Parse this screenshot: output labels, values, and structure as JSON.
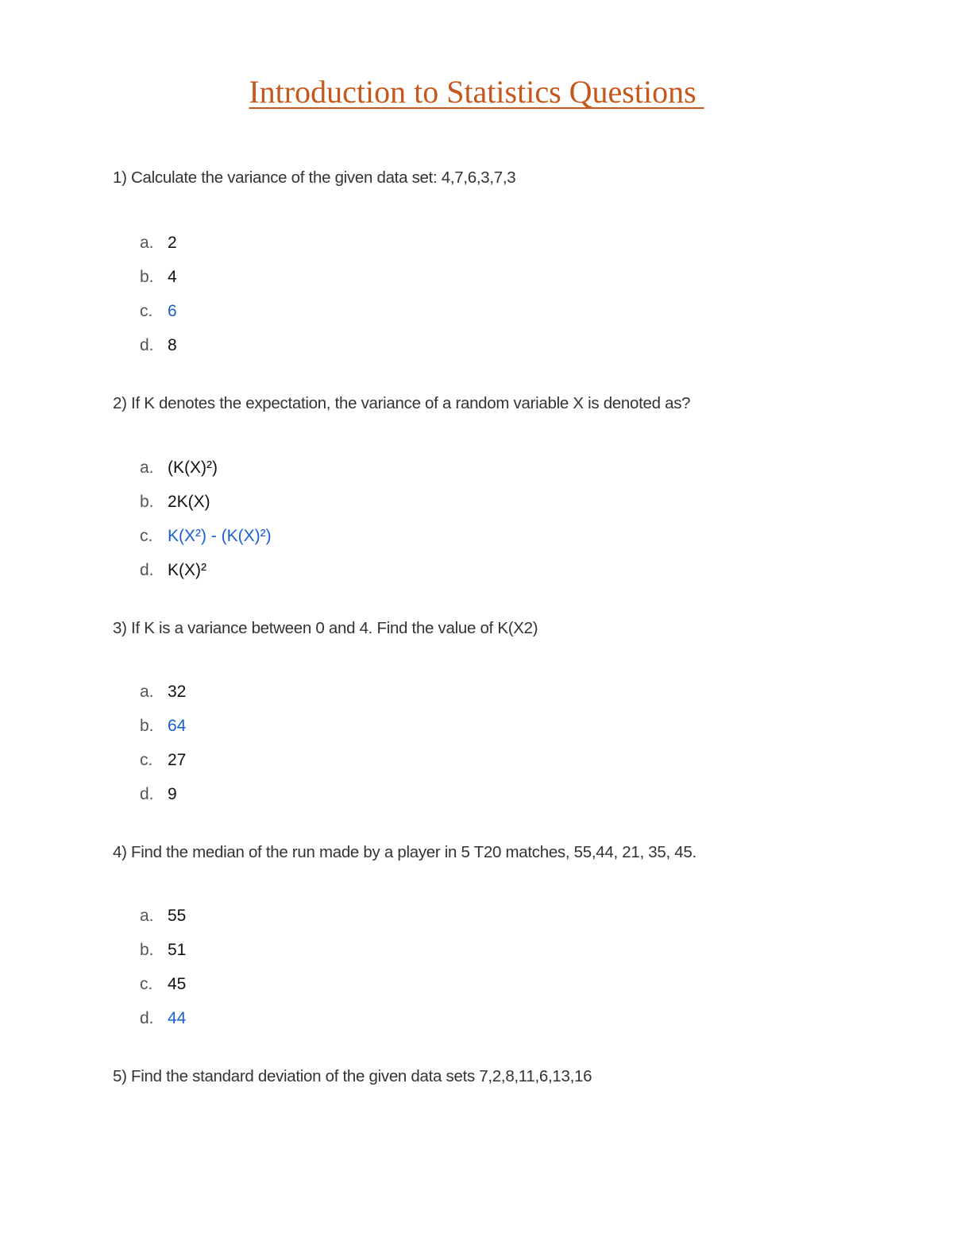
{
  "document": {
    "title": "Introduction to Statistics Questions ",
    "correct_answer_color": "#1a5fd0",
    "title_color": "#c5581d"
  },
  "questions": [
    {
      "number": "1)",
      "text": "Calculate the variance of the given data set: 4,7,6,3,7,3",
      "options": [
        {
          "letter": "a.",
          "value": "2",
          "correct": false
        },
        {
          "letter": "b.",
          "value": "4",
          "correct": false
        },
        {
          "letter": "c.",
          "value": "6",
          "correct": true
        },
        {
          "letter": "d.",
          "value": "8",
          "correct": false
        }
      ]
    },
    {
      "number": "2)",
      "text": "If K denotes the expectation, the variance of a random variable X is denoted as?",
      "options": [
        {
          "letter": "a.",
          "value": "(K(X)²)",
          "correct": false
        },
        {
          "letter": "b.",
          "value": "2K(X)",
          "correct": false
        },
        {
          "letter": "c.",
          "value": "K(X²) - (K(X)²)",
          "correct": true
        },
        {
          "letter": "d.",
          "value": "K(X)²",
          "correct": false
        }
      ]
    },
    {
      "number": "3)",
      "text": "If K is a variance between 0 and 4. Find the value of K(X2)",
      "options": [
        {
          "letter": "a.",
          "value": "32",
          "correct": false
        },
        {
          "letter": "b.",
          "value": "64",
          "correct": true
        },
        {
          "letter": "c.",
          "value": "27",
          "correct": false
        },
        {
          "letter": "d.",
          "value": "9",
          "correct": false
        }
      ]
    },
    {
      "number": "4)",
      "text": "Find the median of the run made by a player in 5 T20 matches, 55,44, 21, 35, 45.",
      "options": [
        {
          "letter": "a.",
          "value": "55",
          "correct": false
        },
        {
          "letter": "b.",
          "value": "51",
          "correct": false
        },
        {
          "letter": "c.",
          "value": "45",
          "correct": false
        },
        {
          "letter": "d.",
          "value": "44",
          "correct": true
        }
      ]
    },
    {
      "number": "5)",
      "text": "Find the standard deviation of the given data sets 7,2,8,11,6,13,16",
      "options": []
    }
  ]
}
